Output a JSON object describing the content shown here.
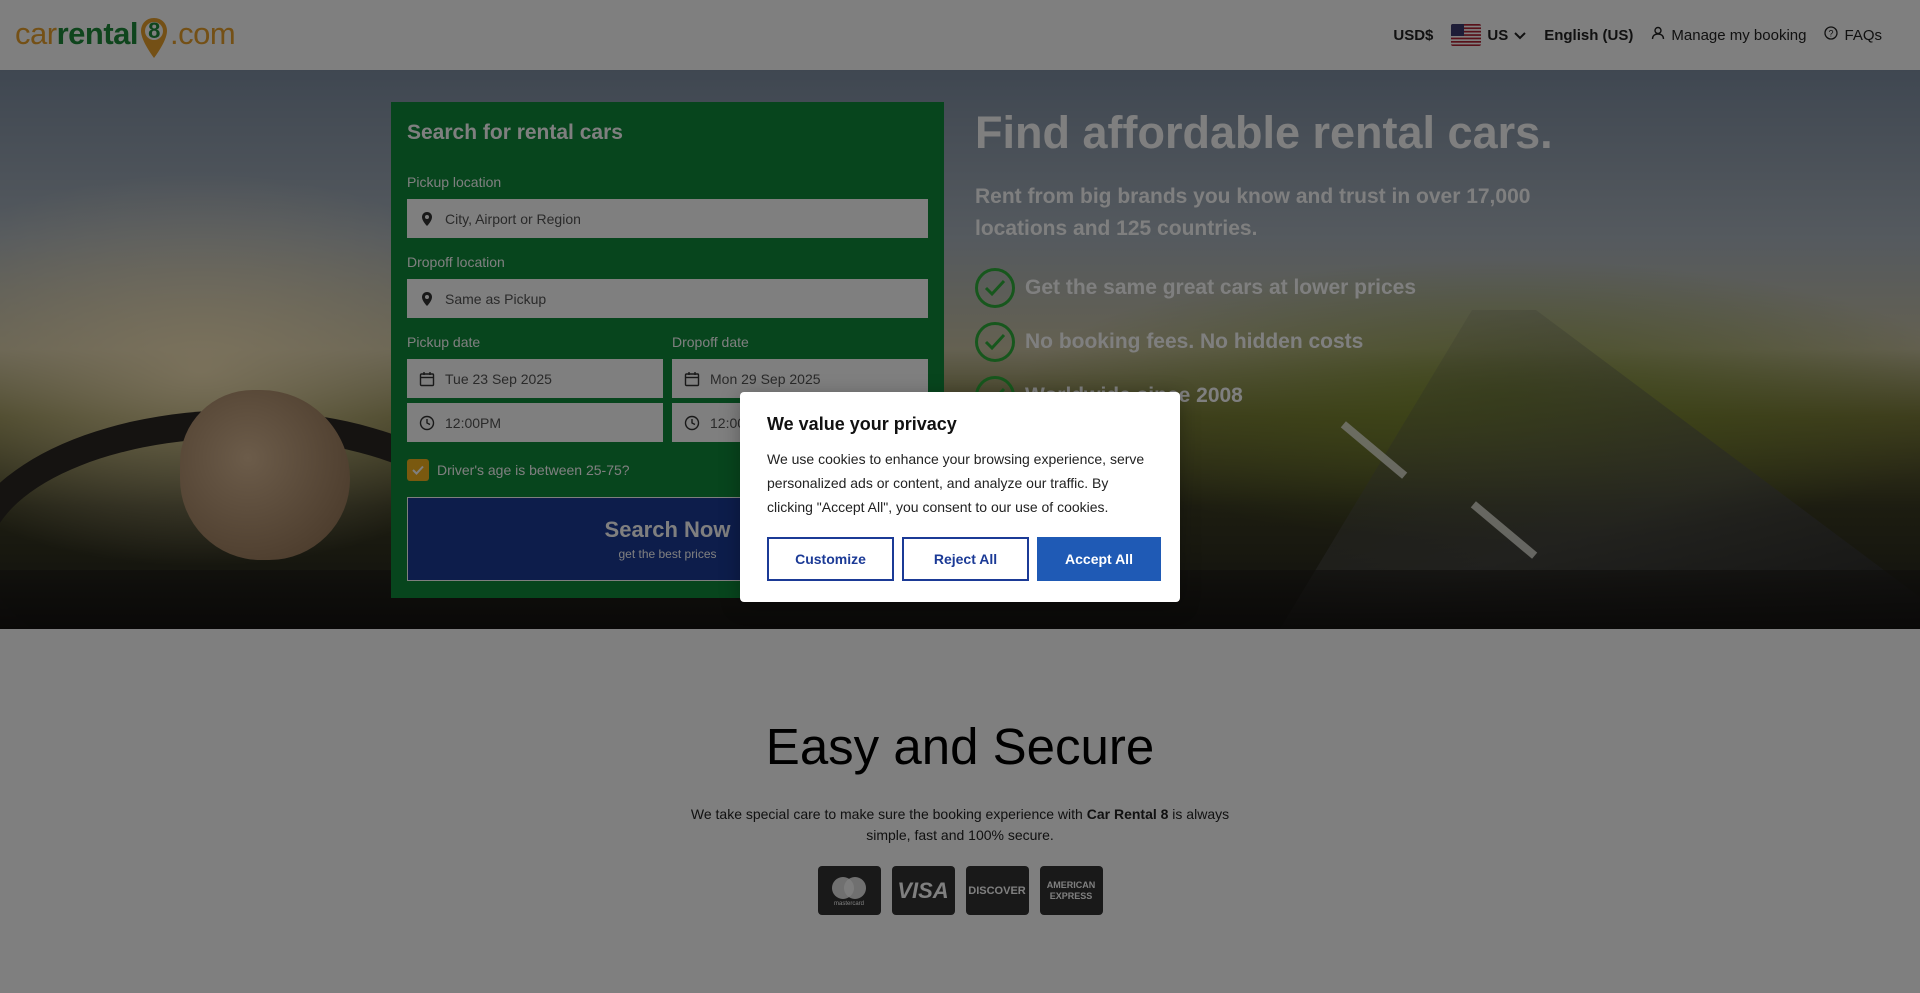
{
  "logo": {
    "part1": "car",
    "part2": "rental",
    "part3": "8",
    "part4": ".com"
  },
  "nav": {
    "currency": "USD$",
    "country": "US",
    "language": "English (US)",
    "manage_booking": "Manage my booking",
    "faqs": "FAQs"
  },
  "search": {
    "title": "Search for rental cars",
    "pickup_label": "Pickup location",
    "pickup_placeholder": "City, Airport or Region",
    "dropoff_label": "Dropoff location",
    "dropoff_placeholder": "Same as Pickup",
    "pickup_date_label": "Pickup date",
    "pickup_date": "Tue 23 Sep 2025",
    "pickup_time": "12:00PM",
    "dropoff_date_label": "Dropoff date",
    "dropoff_date": "Mon 29 Sep 2025",
    "dropoff_time": "12:00PM",
    "age_check_label": "Driver's age is between 25-75?",
    "button_title": "Search Now",
    "button_sub": "get the best prices"
  },
  "hero": {
    "title": "Find affordable rental cars.",
    "subtitle": "Rent from big brands you know and trust in over 17,000 locations and 125 countries.",
    "bullets": [
      "Get the same great cars at lower prices",
      "No booking fees. No hidden costs",
      "Worldwide since 2008"
    ]
  },
  "easy": {
    "title": "Easy and Secure",
    "text_before": "We take special care to make sure the booking experience with ",
    "text_brand": "Car Rental 8",
    "text_after": " is always simple, fast and 100% secure.",
    "cards": [
      "mastercard",
      "VISA",
      "DISCOVER",
      "AMERICAN EXPRESS"
    ]
  },
  "cookie": {
    "title": "We value your privacy",
    "text": "We use cookies to enhance your browsing experience, serve personalized ads or content, and analyze our traffic. By clicking \"Accept All\", you consent to our use of cookies.",
    "customize": "Customize",
    "reject": "Reject All",
    "accept": "Accept All"
  },
  "colors": {
    "brand_green": "#0e8a3a",
    "brand_orange": "#e8a12c",
    "button_blue": "#1b3a96",
    "accept_blue": "#1f5ab5",
    "check_yellow": "#f5b31f"
  }
}
